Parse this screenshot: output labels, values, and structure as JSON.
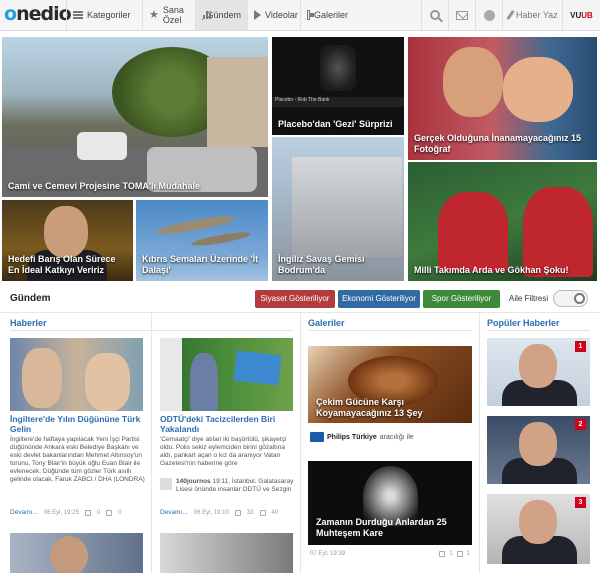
{
  "header": {
    "logo": "onedio",
    "nav": [
      {
        "label": "Kategoriler",
        "icon": "menu-icon"
      },
      {
        "label": "Sana Özel",
        "icon": "star-icon"
      },
      {
        "label": "Gündem",
        "icon": "bar-chart-icon"
      },
      {
        "label": "Videolar",
        "icon": "play-icon"
      },
      {
        "label": "Galeriler",
        "icon": "gallery-icon"
      }
    ],
    "write_label": "Haber Yaz",
    "partner": "VUUB"
  },
  "hero": [
    {
      "caption": "Cami ve Cemevi Projesine TOMA'lı Müdahale"
    },
    {
      "caption": "Placebo'dan 'Gezi' Sürprizi",
      "video_channel": "Placebo - Rob The Bank"
    },
    {
      "caption": "Gerçek Olduğuna İnanamayacağınız 15 Fotoğraf"
    },
    {
      "caption": "İngiliz Savaş Gemisi Bodrum'da"
    },
    {
      "caption": "Milli Takımda Arda ve Gökhan Şoku!"
    },
    {
      "caption": "Hedefi Barış Olan Sürece En İdeal Katkıyı Veririz"
    },
    {
      "caption": "Kıbrıs Semaları Üzerinde 'İt Dalaşı'"
    }
  ],
  "gundem": {
    "title": "Gündem",
    "filters": [
      "Siyaset Gösteriliyor",
      "Ekonomi Gösteriliyor",
      "Spor Gösteriliyor"
    ],
    "family_filter_label": "Aile Filtresi"
  },
  "columns": {
    "haberler": "Haberler",
    "galeriler": "Galeriler",
    "populer": "Popüler Haberler"
  },
  "news": [
    {
      "title": "İngiltere'de Yılın Düğününe Türk Gelin",
      "text": "İngiltere'de haftaya yapılacak Yeni İşçi Partisi düğününde Ankara eski Belediye Başkanı ve eski devlet bakanlarından Mehmet Altınsoy'un torunu, Tony Blair'in büyük oğlu Euan Blair ile evlenecek. Düğünde tüm gözler Türk asıllı gelinde olacak. Faruk ZABCI / DHA (LONDRA)",
      "more": "Devamı...",
      "date": "06 Eyl, 19:25",
      "shares": "0",
      "comments": "0"
    },
    {
      "title": "ODTÜ'deki Tacizcilerden Biri Yakalandı",
      "text": "'Cemaatçi' diye atılan iki başörtülü, şikayetçi oldu. Polis sekiz eylemciden birini gözaltına aldı, pankart açan o kız da aranıyor Vatan Gazetesi'nin haberine göre",
      "tweet_user": "140journos",
      "tweet_text": "19:11, İstanbul. Galatasaray Lisesi önünde insanlar ODTÜ ve Sezgin",
      "more": "Devamı...",
      "date": "06 Eyl, 19:10",
      "shares": "33",
      "comments": "40"
    }
  ],
  "galleries": [
    {
      "title": "Çekim Gücüne Karşı Koyamayacağınız 13 Şey",
      "sponsor": "Philips Türkiye",
      "sponsor_suffix": "aracılığı ile"
    },
    {
      "title": "Zamanın Durduğu Anlardan 25 Muhteşem Kare",
      "date": "07 Eyl, 19:39",
      "shares": "1",
      "comments": "1"
    }
  ],
  "popular": [
    "1",
    "2",
    "3"
  ]
}
